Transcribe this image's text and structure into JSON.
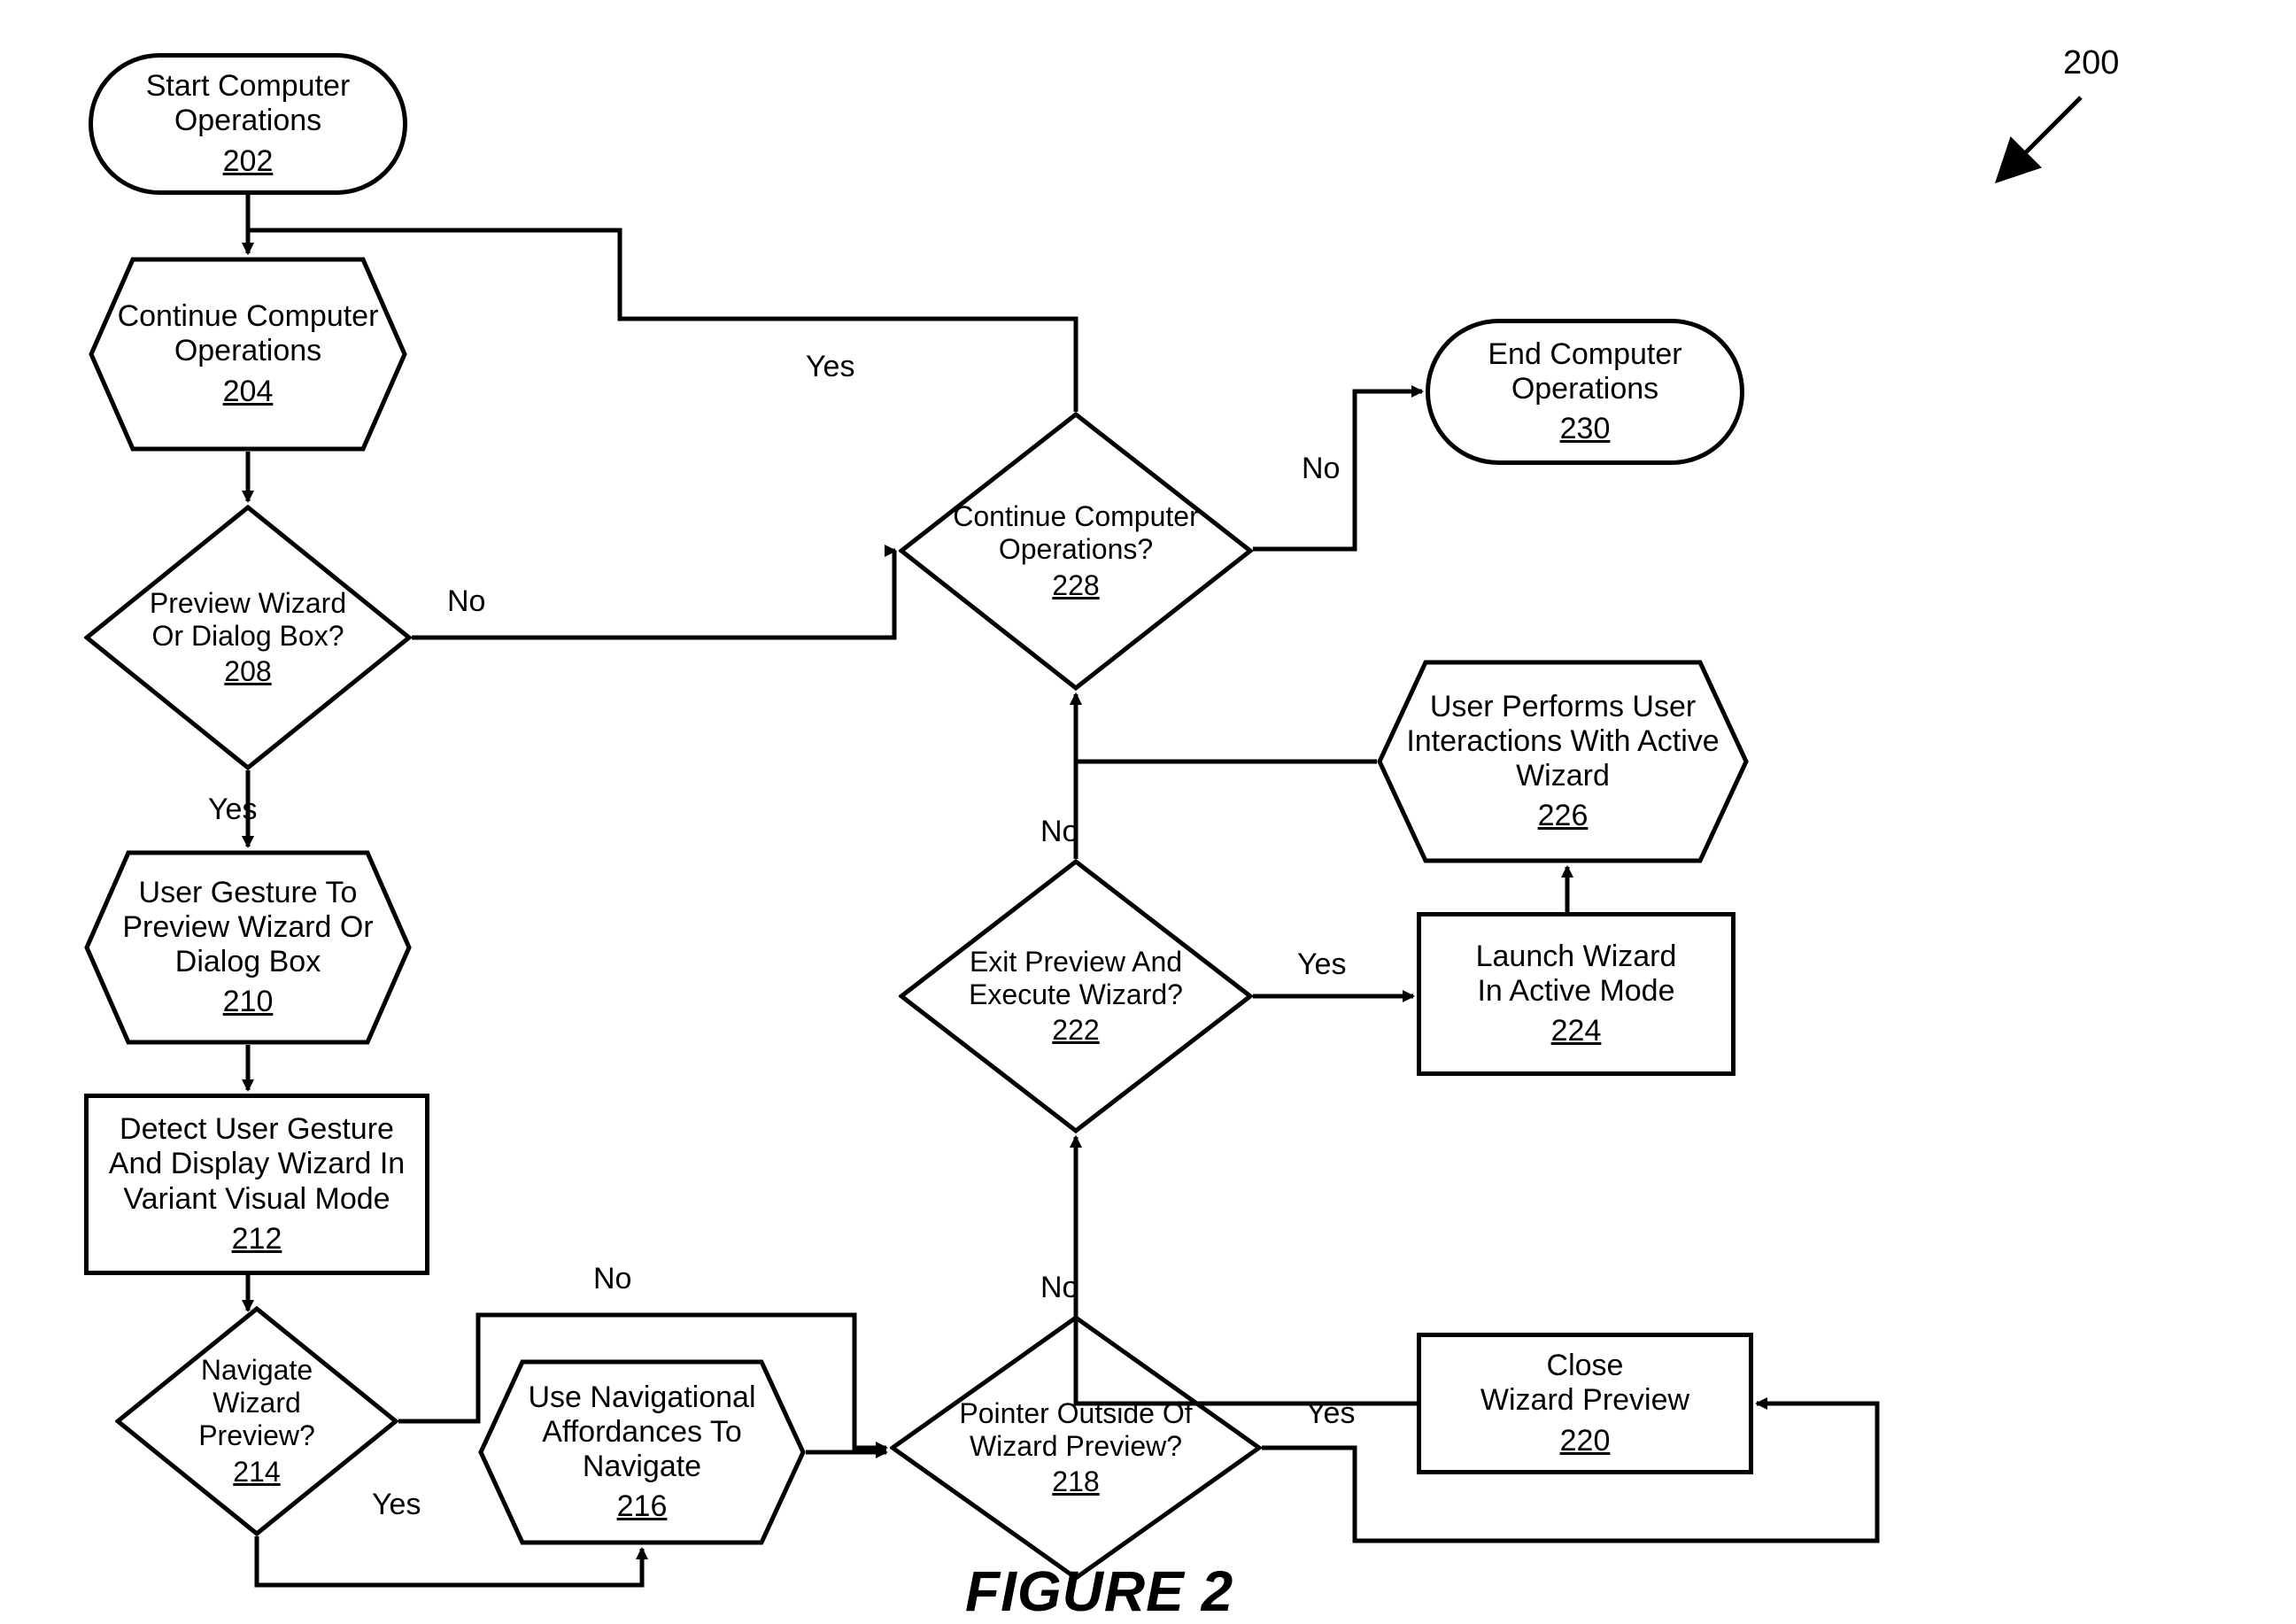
{
  "figure": {
    "number_label": "200",
    "caption": "FIGURE 2"
  },
  "nodes": {
    "n202": {
      "label": "Start Computer\nOperations",
      "num": "202"
    },
    "n204": {
      "label": "Continue\nComputer\nOperations",
      "num": "204"
    },
    "n208": {
      "label": "Preview\nWizard Or\nDialog Box?",
      "num": "208"
    },
    "n210": {
      "label": "User Gesture To\nPreview Wizard\nOr Dialog Box",
      "num": "210"
    },
    "n212": {
      "label": "Detect User Gesture\nAnd Display Wizard In\nVariant Visual Mode",
      "num": "212"
    },
    "n214": {
      "label": "Navigate\nWizard\nPreview?",
      "num": "214"
    },
    "n216": {
      "label": "Use Navigational\nAffordances To\nNavigate",
      "num": "216"
    },
    "n218": {
      "label": "Pointer\nOutside Of Wizard\nPreview?",
      "num": "218"
    },
    "n220": {
      "label": "Close\nWizard Preview",
      "num": "220"
    },
    "n222": {
      "label": "Exit\nPreview And\nExecute Wizard?",
      "num": "222"
    },
    "n224": {
      "label": "Launch Wizard\nIn Active Mode",
      "num": "224"
    },
    "n226": {
      "label": "User Performs\nUser Interactions\nWith Active Wizard",
      "num": "226"
    },
    "n228": {
      "label": "Continue\nComputer\nOperations?",
      "num": "228"
    },
    "n230": {
      "label": "End Computer\nOperations",
      "num": "230"
    }
  },
  "edge_labels": {
    "e208_yes": "Yes",
    "e208_no": "No",
    "e214_yes": "Yes",
    "e214_no": "No",
    "e218_yes": "Yes",
    "e218_no": "No",
    "e222_yes": "Yes",
    "e222_no": "No",
    "e228_yes": "Yes",
    "e228_no": "No"
  }
}
